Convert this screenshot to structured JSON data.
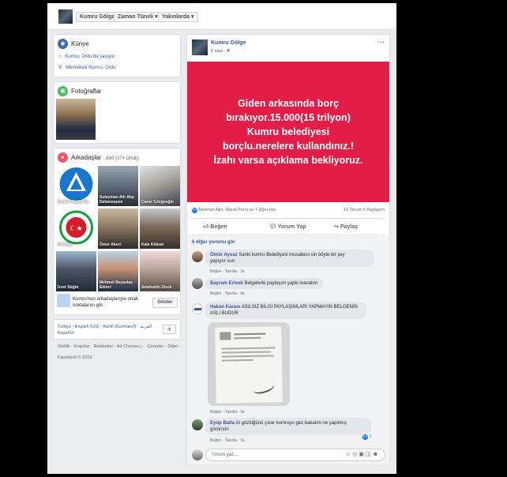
{
  "topbar": {
    "name": "Kumru Gölge",
    "timeline": "Zaman Tüneli",
    "nearby": "Yakınlarda"
  },
  "intro": {
    "title": "Künye",
    "lives": "Kumru, Ordu'da yaşıyor",
    "from": "Memleketi Kumru, Ordu"
  },
  "photos": {
    "title": "Fotoğraflar"
  },
  "friends": {
    "title": "Arkadaşlar",
    "count": "· 850 (374 Ortak)",
    "items": [
      "Ordu İl Sağlık M...",
      "Suleyman Alir Akp Dekansayon",
      "Caner Görgeoğlu",
      "Derneği",
      "Ömer Akeci",
      "Kale Kökzai",
      "İzzet Süğür",
      "Mehmet Beyaztaş Ekinci",
      "Selahattin Dizek"
    ],
    "share_text": "Kumru'nun arkadaşlarıyla ortak noktalarını gör.",
    "share_button": "Göster"
  },
  "languages": {
    "items": "Türkçe · English (US) · Kurdî (Kurmancî) · العربية · Español",
    "plus": "+"
  },
  "footer": {
    "links": "Gizlilik · Koşullar · Reklamlar · Ad Choices ▷ · Çerezler · Diğer ·",
    "copyright": "Facebook © 2019"
  },
  "post": {
    "author": "Kumru Gölge",
    "time": "8 saat ·",
    "more": "···",
    "image_text": [
      "Giden arkasında borç",
      "bırakıyor.15.000(15 trilyon)",
      "Kumru belediyesi",
      "borçlu.nerelere kullandınız.!",
      "İzahı varsa açıklama bekliyoruz."
    ],
    "reactions": "Mehmet Ağır, Murat Perni ve 7 diğer kişi",
    "counts": "10 Yorum  5 Paylaşım",
    "like": "Beğen",
    "comment": "Yorum Yap",
    "share": "Paylaş",
    "more_comments": "6 diğer yorumu gör",
    "write_placeholder": "Yorum yaz..."
  },
  "comments": [
    {
      "name": "Ömür Ayvaz",
      "text1": "Sanki kumru Belediyesi musabeci sin böyle bir şey",
      "text2": "yapıyor sun",
      "actions": "Beğen · Yanıtla · 3s"
    },
    {
      "name": "Bayram Erloek",
      "text1": "Belgelerle paylaşım yapki inanalım",
      "text2": "",
      "actions": "Beğen · Yanıtla · 4s"
    },
    {
      "name": "Hakan Karaoı",
      "text1": "ASILSIZ BİLGİ PAYLAŞIMLARI YAPMAYIN BELGENİN",
      "text2": "ASLI BUDUR",
      "actions": "Beğen · Yanıtla · 3s"
    },
    {
      "name": "Eyüp Balta",
      "text1": "At gözlüğünü çıkar kumruyu gez bakalım ne yapılmış",
      "text2": "görürsün",
      "actions": "Beğen · Yanıtla · 3s",
      "likes": "1"
    }
  ],
  "colors": {
    "post_bg": "#e11d48",
    "facebook_blue": "#385898",
    "page_bg": "#e9ebee"
  }
}
